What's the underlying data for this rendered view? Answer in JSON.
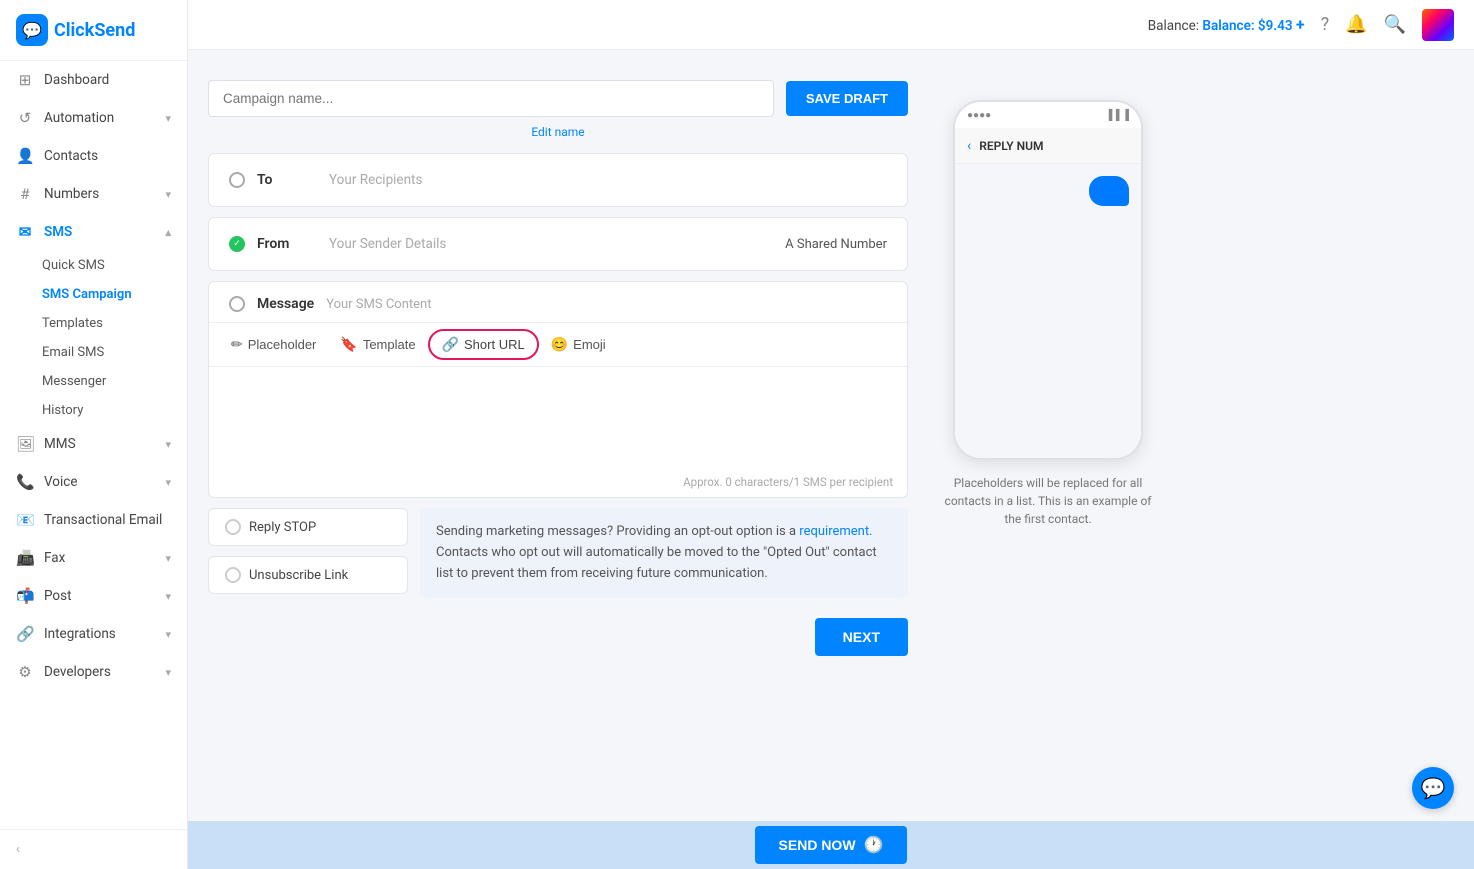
{
  "app": {
    "logo_text_black": "Click",
    "logo_text_blue": "Send",
    "logo_icon": "💬"
  },
  "topbar": {
    "balance_label": "Balance: $9.43",
    "balance_plus": "+",
    "help_icon": "?",
    "bell_icon": "🔔",
    "search_icon": "🔍"
  },
  "sidebar": {
    "items": [
      {
        "id": "dashboard",
        "label": "Dashboard",
        "icon": "⊞",
        "has_sub": false
      },
      {
        "id": "automation",
        "label": "Automation",
        "icon": "↺",
        "has_sub": true
      },
      {
        "id": "contacts",
        "label": "Contacts",
        "icon": "👤",
        "has_sub": false
      },
      {
        "id": "numbers",
        "label": "Numbers",
        "icon": "#",
        "has_sub": true
      },
      {
        "id": "sms",
        "label": "SMS",
        "icon": "✉",
        "has_sub": true,
        "expanded": true
      },
      {
        "id": "mms",
        "label": "MMS",
        "icon": "🖼",
        "has_sub": true
      },
      {
        "id": "voice",
        "label": "Voice",
        "icon": "📞",
        "has_sub": true
      },
      {
        "id": "transactional-email",
        "label": "Transactional Email",
        "icon": "📧",
        "has_sub": false
      },
      {
        "id": "fax",
        "label": "Fax",
        "icon": "📠",
        "has_sub": true
      },
      {
        "id": "post",
        "label": "Post",
        "icon": "📬",
        "has_sub": true
      },
      {
        "id": "integrations",
        "label": "Integrations",
        "icon": "🔗",
        "has_sub": true
      },
      {
        "id": "developers",
        "label": "Developers",
        "icon": "⚙",
        "has_sub": true
      }
    ],
    "sms_sub_items": [
      {
        "id": "quick-sms",
        "label": "Quick SMS"
      },
      {
        "id": "sms-campaign",
        "label": "SMS Campaign",
        "active": true
      },
      {
        "id": "templates",
        "label": "Templates"
      },
      {
        "id": "email-sms",
        "label": "Email SMS"
      },
      {
        "id": "messenger",
        "label": "Messenger"
      },
      {
        "id": "history",
        "label": "History"
      }
    ],
    "collapse_label": "‹"
  },
  "form": {
    "campaign_name_placeholder": "Campaign name...",
    "save_draft_label": "SAVE DRAFT",
    "edit_name_label": "Edit name",
    "to_label": "To",
    "to_placeholder": "Your Recipients",
    "from_label": "From",
    "from_placeholder": "Your Sender Details",
    "from_right": "A Shared Number",
    "message_label": "Message",
    "message_placeholder": "Your SMS Content",
    "placeholder_btn": "Placeholder",
    "template_btn": "Template",
    "short_url_btn": "Short URL",
    "emoji_btn": "Emoji",
    "char_count": "Approx. 0 characters/1 SMS per recipient",
    "reply_stop_label": "Reply STOP",
    "unsubscribe_label": "Unsubscribe Link",
    "info_title": "Sending marketing messages? Providing an opt-out option is a",
    "info_link": "requirement.",
    "info_body": "Contacts who opt out will automatically be moved to the \"Opted Out\" contact list to prevent them from receiving future communication.",
    "next_btn": "NEXT",
    "send_now_btn": "SEND NOW"
  },
  "preview": {
    "reply_num": "REPLY NUM",
    "caption": "Placeholders will be replaced for all contacts in a list. This is an example of the first contact."
  },
  "colors": {
    "brand_blue": "#0084ff",
    "highlight_pink": "#e0185a"
  }
}
